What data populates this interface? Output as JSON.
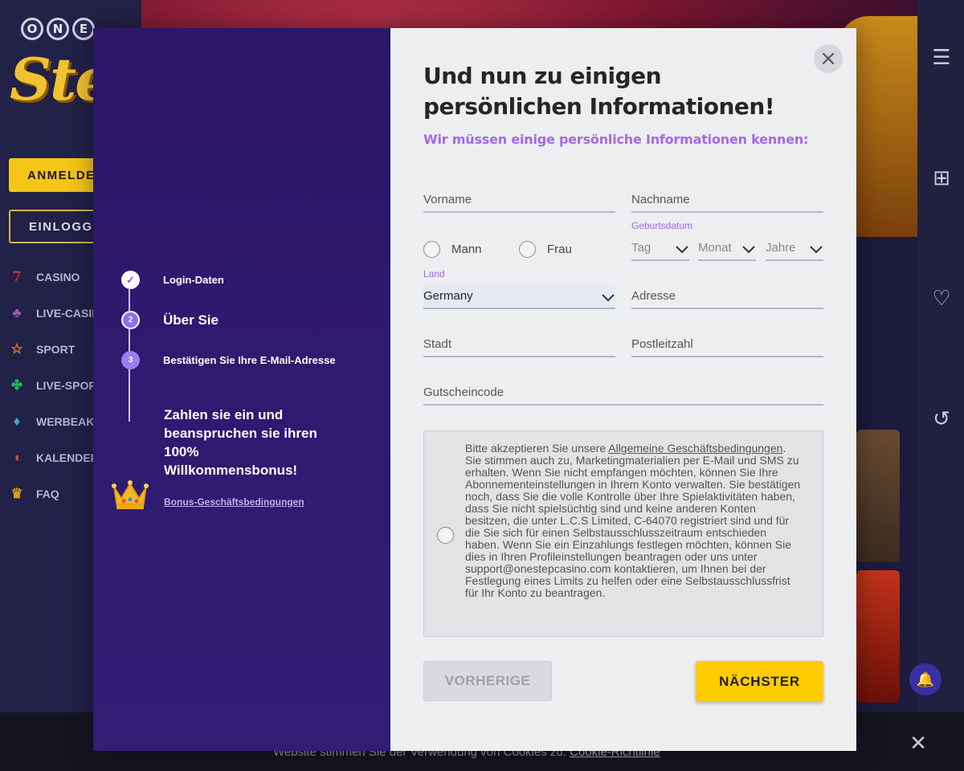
{
  "background": {
    "logo_letters": [
      "O",
      "N",
      "E"
    ],
    "logo_word": "Step",
    "signup_button": "ANMELDEN",
    "login_button": "EINLOGGEN",
    "nav": [
      {
        "label": "CASINO",
        "icon": "seven-icon",
        "color": "#c0392b",
        "glyph": "7"
      },
      {
        "label": "LIVE-CASINO",
        "icon": "club-icon",
        "color": "#9b59b6",
        "glyph": "♣"
      },
      {
        "label": "SPORT",
        "icon": "star-icon",
        "color": "#e67e22",
        "glyph": "☆"
      },
      {
        "label": "LIVE-SPORT",
        "icon": "clover-icon",
        "color": "#27ae60",
        "glyph": "✤"
      },
      {
        "label": "WERBEAKTIONEN",
        "icon": "diamond-icon",
        "color": "#3aa6d8",
        "glyph": "♦"
      },
      {
        "label": "KALENDER",
        "icon": "melon-icon",
        "color": "#e74c3c",
        "glyph": "◖"
      },
      {
        "label": "FAQ",
        "icon": "crown-icon",
        "color": "#d4a017",
        "glyph": "♛"
      }
    ],
    "cookie_text": "Website stimmen Sie der Verwendung von Cookies zu.",
    "cookie_link": "Cookie-Richtlinie"
  },
  "steps": [
    {
      "label": "Login-Daten",
      "state": "done",
      "marker": "✓"
    },
    {
      "label": "Über Sie",
      "state": "active",
      "marker": "2"
    },
    {
      "label": "Bestätigen Sie Ihre E-Mail-Adresse",
      "state": "todo",
      "marker": "3"
    }
  ],
  "bonus": {
    "text": "Zahlen sie ein und beanspruchen sie ihren 100% Willkommensbonus!",
    "link": "Bonus-Geschäftsbedingungen"
  },
  "form": {
    "title": "Und nun zu einigen persönlichen Informationen!",
    "subtitle": "Wir müssen einige persönliche Informationen kennen:",
    "vorname": "Vorname",
    "nachname": "Nachname",
    "gender_male": "Mann",
    "gender_female": "Frau",
    "birthdate_label": "Geburtsdatum",
    "day": "Tag",
    "month": "Monat",
    "year": "Jahre",
    "country_label": "Land",
    "country_value": "Germany",
    "address": "Adresse",
    "city": "Stadt",
    "postcode": "Postleitzahl",
    "voucher": "Gutscheincode",
    "terms_intro": "Bitte akzeptieren Sie unsere",
    "terms_link": "Allgemeine Geschäftsbedingungen",
    "terms_body": ". Sie stimmen auch zu, Marketingmaterialien per E-Mail und SMS zu erhalten. Wenn Sie nicht empfangen möchten, können Sie Ihre Abonnementeinstellungen in Ihrem Konto verwalten. Sie bestätigen noch, dass Sie die volle Kontrolle über Ihre Spielaktivitäten haben, dass Sie nicht spielsüchtig sind und keine anderen Konten besitzen, die unter L.C.S Limited, C-64070 registriert sind und für die Sie sich für einen Selbstausschlusszeitraum entschieden haben. Wenn Sie ein Einzahlungs festlegen möchten, können Sie dies in Ihren Profileinstellungen beantragen oder uns unter support@onestepcasino.com kontaktieren, um Ihnen bei der Festlegung eines Limits zu helfen oder eine Selbstausschlussfrist für Ihr Konto zu beantragen.",
    "prev_button": "VORHERIGE",
    "next_button": "NÄCHSTER",
    "close_glyph": "×"
  },
  "colors": {
    "accent_purple": "#a26ae4",
    "primary_yellow": "#ffcc00",
    "panel_purple": "#2e1a6f"
  }
}
